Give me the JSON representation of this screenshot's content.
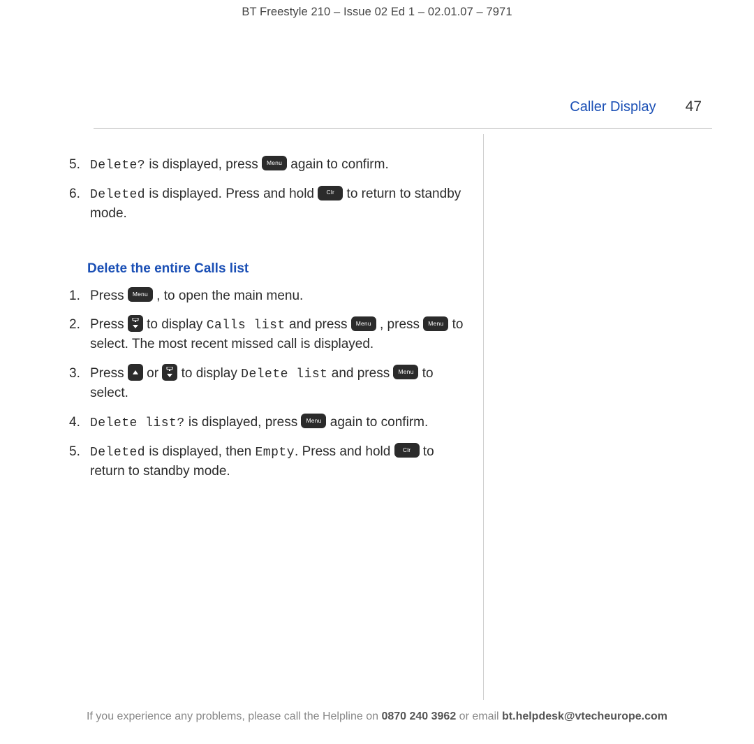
{
  "header": "BT Freestyle 210 – Issue 02 Ed 1 – 02.01.07 – 7971",
  "running_head": {
    "section": "Caller Display",
    "page": "47"
  },
  "keys": {
    "menu": "Menu",
    "clr": "Clr"
  },
  "topSteps": [
    {
      "num": "5.",
      "parts": [
        {
          "t": "lcd",
          "v": "Delete?"
        },
        {
          "t": "text",
          "v": " is displayed, press "
        },
        {
          "t": "key",
          "v": "menu"
        },
        {
          "t": "text",
          "v": " again to confirm."
        }
      ]
    },
    {
      "num": "6.",
      "parts": [
        {
          "t": "lcd",
          "v": "Deleted"
        },
        {
          "t": "text",
          "v": " is displayed. Press and hold "
        },
        {
          "t": "key",
          "v": "clr"
        },
        {
          "t": "text",
          "v": " to return to standby mode."
        }
      ]
    }
  ],
  "subhead": "Delete the entire Calls list",
  "steps": [
    {
      "num": "1.",
      "parts": [
        {
          "t": "text",
          "v": "Press "
        },
        {
          "t": "key",
          "v": "menu"
        },
        {
          "t": "text",
          "v": ", to open the main menu."
        }
      ]
    },
    {
      "num": "2.",
      "parts": [
        {
          "t": "text",
          "v": "Press "
        },
        {
          "t": "key",
          "v": "down"
        },
        {
          "t": "text",
          "v": " to display "
        },
        {
          "t": "lcd",
          "v": "Calls list"
        },
        {
          "t": "text",
          "v": " and press "
        },
        {
          "t": "key",
          "v": "menu"
        },
        {
          "t": "text",
          "v": ", press "
        },
        {
          "t": "key",
          "v": "menu"
        },
        {
          "t": "text",
          "v": " to select. The most recent missed call is displayed."
        }
      ]
    },
    {
      "num": "3.",
      "parts": [
        {
          "t": "text",
          "v": "Press"
        },
        {
          "t": "key",
          "v": "up"
        },
        {
          "t": "text",
          "v": " or "
        },
        {
          "t": "key",
          "v": "down"
        },
        {
          "t": "text",
          "v": " to display "
        },
        {
          "t": "lcd",
          "v": "Delete list"
        },
        {
          "t": "text",
          "v": " and press "
        },
        {
          "t": "key",
          "v": "menu"
        },
        {
          "t": "text",
          "v": " to select."
        }
      ]
    },
    {
      "num": "4.",
      "parts": [
        {
          "t": "lcd",
          "v": "Delete list?"
        },
        {
          "t": "text",
          "v": " is displayed, press "
        },
        {
          "t": "key",
          "v": "menu"
        },
        {
          "t": "text",
          "v": " again to confirm."
        }
      ]
    },
    {
      "num": "5.",
      "parts": [
        {
          "t": "lcd",
          "v": "Deleted"
        },
        {
          "t": "text",
          "v": " is displayed, then "
        },
        {
          "t": "lcd",
          "v": "Empty"
        },
        {
          "t": "text",
          "v": ". Press and hold "
        },
        {
          "t": "key",
          "v": "clr"
        },
        {
          "t": "text",
          "v": " to return to standby mode."
        }
      ]
    }
  ],
  "footer": {
    "pre": "If you experience any problems, please call the Helpline on ",
    "phone": "0870 240 3962",
    "mid": " or email ",
    "email": "bt.helpdesk@vtecheurope.com"
  }
}
